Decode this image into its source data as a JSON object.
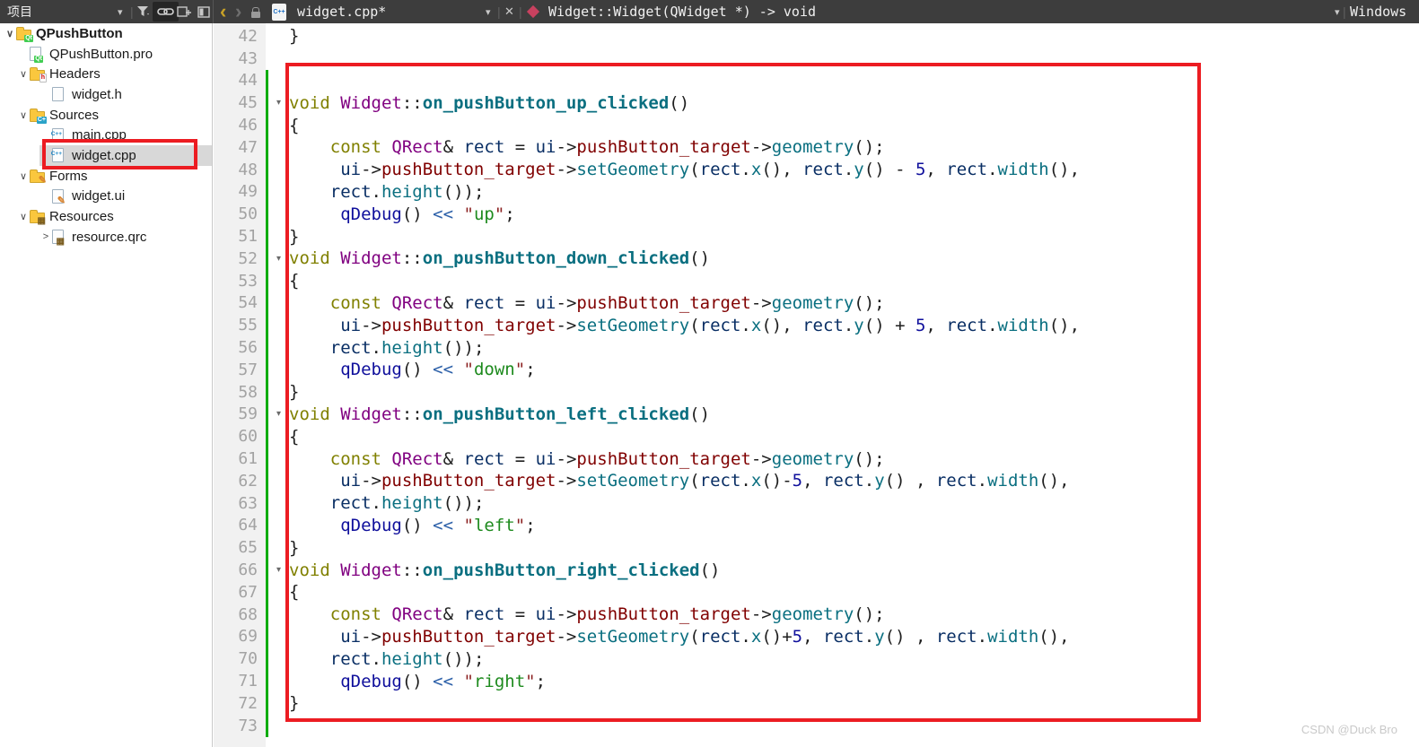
{
  "window": {
    "os_label": "Windows"
  },
  "icons": {
    "caret": "▾",
    "close": "✕",
    "back": "‹",
    "forward": "›",
    "expanded_chevron": "∨",
    "collapsed_chevron": ">",
    "fold_marker": "▾",
    "cpp_doc_label": "C++"
  },
  "project_panel": {
    "title": "项目",
    "tree": [
      {
        "label": "QPushButton",
        "icon": "qt-project-folder-icon",
        "badge": "Qt",
        "level": 0,
        "state": "expanded",
        "bold": true
      },
      {
        "label": "QPushButton.pro",
        "icon": "qt-pro-file-icon",
        "badge": "Qt",
        "level": 1,
        "state": "none"
      },
      {
        "label": "Headers",
        "icon": "headers-folder-icon",
        "badge": "h",
        "level": 1,
        "state": "expanded"
      },
      {
        "label": "widget.h",
        "icon": "header-file-icon",
        "badge": "",
        "level": 2,
        "state": "none"
      },
      {
        "label": "Sources",
        "icon": "sources-folder-icon",
        "badge": "C+",
        "level": 1,
        "state": "expanded"
      },
      {
        "label": "main.cpp",
        "icon": "cpp-file-icon",
        "badge": "C++",
        "level": 2,
        "state": "none"
      },
      {
        "label": "widget.cpp",
        "icon": "cpp-file-icon",
        "badge": "C++",
        "level": 2,
        "state": "none",
        "selected": true
      },
      {
        "label": "Forms",
        "icon": "forms-folder-icon",
        "badge": "✎",
        "level": 1,
        "state": "expanded"
      },
      {
        "label": "widget.ui",
        "icon": "ui-file-icon",
        "badge": "✎",
        "level": 2,
        "state": "none"
      },
      {
        "label": "Resources",
        "icon": "resources-folder-icon",
        "badge": "▦",
        "level": 1,
        "state": "expanded"
      },
      {
        "label": "resource.qrc",
        "icon": "qrc-file-icon",
        "badge": "▦",
        "level": 2,
        "state": "collapsed"
      }
    ]
  },
  "editor": {
    "tab_title": "widget.cpp*",
    "symbol": "Widget::Widget(QWidget *) -> void",
    "lines": [
      {
        "n": 42,
        "t": [
          [
            "p",
            "}"
          ]
        ]
      },
      {
        "n": 43,
        "t": []
      },
      {
        "n": 44,
        "chg": 1,
        "t": []
      },
      {
        "n": 45,
        "chg": 1,
        "fold": 1,
        "t": [
          [
            "k",
            "void"
          ],
          [
            "p",
            " "
          ],
          [
            "t",
            "Widget"
          ],
          [
            "p",
            "::"
          ],
          [
            "f",
            "on_pushButton_up_clicked"
          ],
          [
            "p",
            "()"
          ]
        ]
      },
      {
        "n": 46,
        "chg": 1,
        "t": [
          [
            "p",
            "{"
          ]
        ]
      },
      {
        "n": 47,
        "chg": 1,
        "t": [
          [
            "p",
            "    "
          ],
          [
            "k",
            "const"
          ],
          [
            "p",
            " "
          ],
          [
            "t",
            "QRect"
          ],
          [
            "p",
            "& "
          ],
          [
            "v",
            "rect"
          ],
          [
            "p",
            " = "
          ],
          [
            "v",
            "ui"
          ],
          [
            "p",
            "->"
          ],
          [
            "m",
            "pushButton_target"
          ],
          [
            "p",
            "->"
          ],
          [
            "c",
            "geometry"
          ],
          [
            "p",
            "();"
          ]
        ]
      },
      {
        "n": 48,
        "chg": 1,
        "t": [
          [
            "p",
            "     "
          ],
          [
            "v",
            "ui"
          ],
          [
            "p",
            "->"
          ],
          [
            "m",
            "pushButton_target"
          ],
          [
            "p",
            "->"
          ],
          [
            "c",
            "setGeometry"
          ],
          [
            "p",
            "("
          ],
          [
            "v",
            "rect"
          ],
          [
            "p",
            "."
          ],
          [
            "c",
            "x"
          ],
          [
            "p",
            "(), "
          ],
          [
            "v",
            "rect"
          ],
          [
            "p",
            "."
          ],
          [
            "c",
            "y"
          ],
          [
            "p",
            "() - "
          ],
          [
            "n",
            "5"
          ],
          [
            "p",
            ", "
          ],
          [
            "v",
            "rect"
          ],
          [
            "p",
            "."
          ],
          [
            "c",
            "width"
          ],
          [
            "p",
            "(),"
          ]
        ]
      },
      {
        "n": 49,
        "chg": 1,
        "t": [
          [
            "p",
            "    "
          ],
          [
            "v",
            "rect"
          ],
          [
            "p",
            "."
          ],
          [
            "c",
            "height"
          ],
          [
            "p",
            "());"
          ]
        ]
      },
      {
        "n": 50,
        "chg": 1,
        "t": [
          [
            "p",
            "     "
          ],
          [
            "mac",
            "qDebug"
          ],
          [
            "p",
            "() "
          ],
          [
            "o",
            "<<"
          ],
          [
            "p",
            " "
          ],
          [
            "sq",
            "\""
          ],
          [
            "s",
            "up"
          ],
          [
            "sq",
            "\""
          ],
          [
            "p",
            ";"
          ]
        ]
      },
      {
        "n": 51,
        "chg": 1,
        "t": [
          [
            "p",
            "}"
          ]
        ]
      },
      {
        "n": 52,
        "chg": 1,
        "fold": 1,
        "t": [
          [
            "k",
            "void"
          ],
          [
            "p",
            " "
          ],
          [
            "t",
            "Widget"
          ],
          [
            "p",
            "::"
          ],
          [
            "f",
            "on_pushButton_down_clicked"
          ],
          [
            "p",
            "()"
          ]
        ]
      },
      {
        "n": 53,
        "chg": 1,
        "t": [
          [
            "p",
            "{"
          ]
        ]
      },
      {
        "n": 54,
        "chg": 1,
        "t": [
          [
            "p",
            "    "
          ],
          [
            "k",
            "const"
          ],
          [
            "p",
            " "
          ],
          [
            "t",
            "QRect"
          ],
          [
            "p",
            "& "
          ],
          [
            "v",
            "rect"
          ],
          [
            "p",
            " = "
          ],
          [
            "v",
            "ui"
          ],
          [
            "p",
            "->"
          ],
          [
            "m",
            "pushButton_target"
          ],
          [
            "p",
            "->"
          ],
          [
            "c",
            "geometry"
          ],
          [
            "p",
            "();"
          ]
        ]
      },
      {
        "n": 55,
        "chg": 1,
        "t": [
          [
            "p",
            "     "
          ],
          [
            "v",
            "ui"
          ],
          [
            "p",
            "->"
          ],
          [
            "m",
            "pushButton_target"
          ],
          [
            "p",
            "->"
          ],
          [
            "c",
            "setGeometry"
          ],
          [
            "p",
            "("
          ],
          [
            "v",
            "rect"
          ],
          [
            "p",
            "."
          ],
          [
            "c",
            "x"
          ],
          [
            "p",
            "(), "
          ],
          [
            "v",
            "rect"
          ],
          [
            "p",
            "."
          ],
          [
            "c",
            "y"
          ],
          [
            "p",
            "() + "
          ],
          [
            "n",
            "5"
          ],
          [
            "p",
            ", "
          ],
          [
            "v",
            "rect"
          ],
          [
            "p",
            "."
          ],
          [
            "c",
            "width"
          ],
          [
            "p",
            "(),"
          ]
        ]
      },
      {
        "n": 56,
        "chg": 1,
        "t": [
          [
            "p",
            "    "
          ],
          [
            "v",
            "rect"
          ],
          [
            "p",
            "."
          ],
          [
            "c",
            "height"
          ],
          [
            "p",
            "());"
          ]
        ]
      },
      {
        "n": 57,
        "chg": 1,
        "t": [
          [
            "p",
            "     "
          ],
          [
            "mac",
            "qDebug"
          ],
          [
            "p",
            "() "
          ],
          [
            "o",
            "<<"
          ],
          [
            "p",
            " "
          ],
          [
            "sq",
            "\""
          ],
          [
            "s",
            "down"
          ],
          [
            "sq",
            "\""
          ],
          [
            "p",
            ";"
          ]
        ]
      },
      {
        "n": 58,
        "chg": 1,
        "t": [
          [
            "p",
            "}"
          ]
        ]
      },
      {
        "n": 59,
        "chg": 1,
        "fold": 1,
        "t": [
          [
            "k",
            "void"
          ],
          [
            "p",
            " "
          ],
          [
            "t",
            "Widget"
          ],
          [
            "p",
            "::"
          ],
          [
            "f",
            "on_pushButton_left_clicked"
          ],
          [
            "p",
            "()"
          ]
        ]
      },
      {
        "n": 60,
        "chg": 1,
        "t": [
          [
            "p",
            "{"
          ]
        ]
      },
      {
        "n": 61,
        "chg": 1,
        "t": [
          [
            "p",
            "    "
          ],
          [
            "k",
            "const"
          ],
          [
            "p",
            " "
          ],
          [
            "t",
            "QRect"
          ],
          [
            "p",
            "& "
          ],
          [
            "v",
            "rect"
          ],
          [
            "p",
            " = "
          ],
          [
            "v",
            "ui"
          ],
          [
            "p",
            "->"
          ],
          [
            "m",
            "pushButton_target"
          ],
          [
            "p",
            "->"
          ],
          [
            "c",
            "geometry"
          ],
          [
            "p",
            "();"
          ]
        ]
      },
      {
        "n": 62,
        "chg": 1,
        "t": [
          [
            "p",
            "     "
          ],
          [
            "v",
            "ui"
          ],
          [
            "p",
            "->"
          ],
          [
            "m",
            "pushButton_target"
          ],
          [
            "p",
            "->"
          ],
          [
            "c",
            "setGeometry"
          ],
          [
            "p",
            "("
          ],
          [
            "v",
            "rect"
          ],
          [
            "p",
            "."
          ],
          [
            "c",
            "x"
          ],
          [
            "p",
            "()-"
          ],
          [
            "n",
            "5"
          ],
          [
            "p",
            ", "
          ],
          [
            "v",
            "rect"
          ],
          [
            "p",
            "."
          ],
          [
            "c",
            "y"
          ],
          [
            "p",
            "() , "
          ],
          [
            "v",
            "rect"
          ],
          [
            "p",
            "."
          ],
          [
            "c",
            "width"
          ],
          [
            "p",
            "(),"
          ]
        ]
      },
      {
        "n": 63,
        "chg": 1,
        "t": [
          [
            "p",
            "    "
          ],
          [
            "v",
            "rect"
          ],
          [
            "p",
            "."
          ],
          [
            "c",
            "height"
          ],
          [
            "p",
            "());"
          ]
        ]
      },
      {
        "n": 64,
        "chg": 1,
        "t": [
          [
            "p",
            "     "
          ],
          [
            "mac",
            "qDebug"
          ],
          [
            "p",
            "() "
          ],
          [
            "o",
            "<<"
          ],
          [
            "p",
            " "
          ],
          [
            "sq",
            "\""
          ],
          [
            "s",
            "left"
          ],
          [
            "sq",
            "\""
          ],
          [
            "p",
            ";"
          ]
        ]
      },
      {
        "n": 65,
        "chg": 1,
        "t": [
          [
            "p",
            "}"
          ]
        ]
      },
      {
        "n": 66,
        "chg": 1,
        "fold": 1,
        "t": [
          [
            "k",
            "void"
          ],
          [
            "p",
            " "
          ],
          [
            "t",
            "Widget"
          ],
          [
            "p",
            "::"
          ],
          [
            "f",
            "on_pushButton_right_clicked"
          ],
          [
            "p",
            "()"
          ]
        ]
      },
      {
        "n": 67,
        "chg": 1,
        "t": [
          [
            "p",
            "{"
          ]
        ]
      },
      {
        "n": 68,
        "chg": 1,
        "t": [
          [
            "p",
            "    "
          ],
          [
            "k",
            "const"
          ],
          [
            "p",
            " "
          ],
          [
            "t",
            "QRect"
          ],
          [
            "p",
            "& "
          ],
          [
            "v",
            "rect"
          ],
          [
            "p",
            " = "
          ],
          [
            "v",
            "ui"
          ],
          [
            "p",
            "->"
          ],
          [
            "m",
            "pushButton_target"
          ],
          [
            "p",
            "->"
          ],
          [
            "c",
            "geometry"
          ],
          [
            "p",
            "();"
          ]
        ]
      },
      {
        "n": 69,
        "chg": 1,
        "t": [
          [
            "p",
            "     "
          ],
          [
            "v",
            "ui"
          ],
          [
            "p",
            "->"
          ],
          [
            "m",
            "pushButton_target"
          ],
          [
            "p",
            "->"
          ],
          [
            "c",
            "setGeometry"
          ],
          [
            "p",
            "("
          ],
          [
            "v",
            "rect"
          ],
          [
            "p",
            "."
          ],
          [
            "c",
            "x"
          ],
          [
            "p",
            "()+"
          ],
          [
            "n",
            "5"
          ],
          [
            "p",
            ", "
          ],
          [
            "v",
            "rect"
          ],
          [
            "p",
            "."
          ],
          [
            "c",
            "y"
          ],
          [
            "p",
            "() , "
          ],
          [
            "v",
            "rect"
          ],
          [
            "p",
            "."
          ],
          [
            "c",
            "width"
          ],
          [
            "p",
            "(),"
          ]
        ]
      },
      {
        "n": 70,
        "chg": 1,
        "t": [
          [
            "p",
            "    "
          ],
          [
            "v",
            "rect"
          ],
          [
            "p",
            "."
          ],
          [
            "c",
            "height"
          ],
          [
            "p",
            "());"
          ]
        ]
      },
      {
        "n": 71,
        "chg": 1,
        "t": [
          [
            "p",
            "     "
          ],
          [
            "mac",
            "qDebug"
          ],
          [
            "p",
            "() "
          ],
          [
            "o",
            "<<"
          ],
          [
            "p",
            " "
          ],
          [
            "sq",
            "\""
          ],
          [
            "s",
            "right"
          ],
          [
            "sq",
            "\""
          ],
          [
            "p",
            ";"
          ]
        ]
      },
      {
        "n": 72,
        "chg": 1,
        "t": [
          [
            "p",
            "}"
          ]
        ]
      },
      {
        "n": 73,
        "chg": 1,
        "t": []
      }
    ]
  },
  "annotation_color": "#ec1c22",
  "watermark": "CSDN @Duck Bro"
}
